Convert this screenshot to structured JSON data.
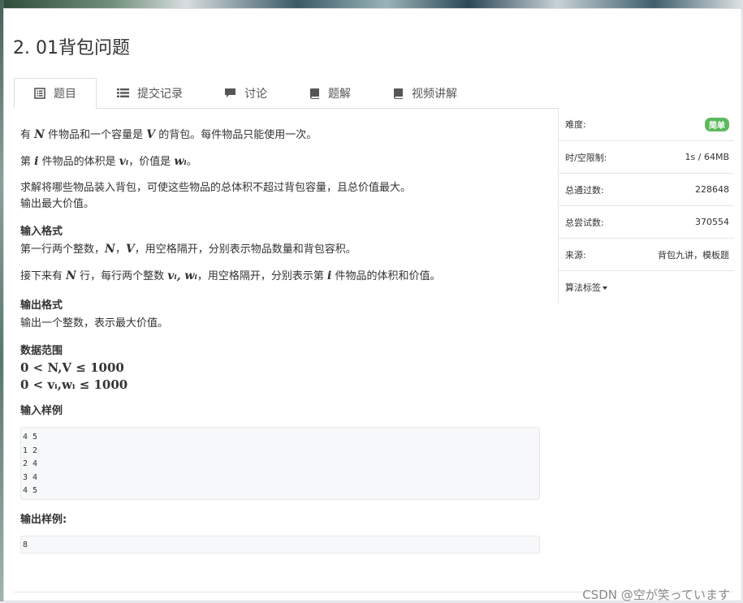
{
  "problem": {
    "title": "2. 01背包问题"
  },
  "tabs": [
    {
      "label": "题目",
      "icon": "list-alt-icon"
    },
    {
      "label": "提交记录",
      "icon": "list-icon"
    },
    {
      "label": "讨论",
      "icon": "comment-icon"
    },
    {
      "label": "题解",
      "icon": "book-icon"
    },
    {
      "label": "视频讲解",
      "icon": "book-icon"
    }
  ],
  "statement": {
    "line1_a": "有 ",
    "line1_N": "N",
    "line1_b": " 件物品和一个容量是 ",
    "line1_V": "V",
    "line1_c": " 的背包。每件物品只能使用一次。",
    "line2_a": "第 ",
    "line2_i": "i",
    "line2_b": " 件物品的体积是 ",
    "line2_vi": "vᵢ",
    "line2_c": "，价值是 ",
    "line2_wi": "wᵢ",
    "line2_d": "。",
    "line3": "求解将哪些物品装入背包，可使这些物品的总体积不超过背包容量，且总价值最大。",
    "line4": "输出最大价值。"
  },
  "input_format": {
    "heading": "输入格式",
    "line1_a": "第一行两个整数，",
    "line1_N": "N",
    "line1_b": "，",
    "line1_V": "V",
    "line1_c": "，用空格隔开，分别表示物品数量和背包容积。",
    "line2_a": "接下来有 ",
    "line2_N": "N",
    "line2_b": " 行，每行两个整数 ",
    "line2_vw": "vᵢ, wᵢ",
    "line2_c": "，用空格隔开，分别表示第 ",
    "line2_i": "i",
    "line2_d": " 件物品的体积和价值。"
  },
  "output_format": {
    "heading": "输出格式",
    "line": "输出一个整数，表示最大价值。"
  },
  "range": {
    "heading": "数据范围",
    "line1": "0 < N,V ≤ 1000",
    "line2": "0 < vᵢ,wᵢ ≤ 1000"
  },
  "sample_input": {
    "heading": "输入样例",
    "lines": [
      "4 5",
      "1 2",
      "2 4",
      "3 4",
      "4 5"
    ]
  },
  "sample_output": {
    "heading": "输出样例:",
    "lines": [
      "8"
    ]
  },
  "sidebar": {
    "rows": [
      {
        "label": "难度:",
        "value": "简单"
      },
      {
        "label": "时/空限制:",
        "value": "1s / 64MB"
      },
      {
        "label": "总通过数:",
        "value": "228648"
      },
      {
        "label": "总尝试数:",
        "value": "370554"
      },
      {
        "label": "来源:",
        "value": "背包九讲，模板题"
      }
    ],
    "tags_label": "算法标签"
  },
  "watermark": "CSDN @空が笑っています",
  "colors": {
    "badge": "#5cb85c",
    "codebox_bg": "#f6f8fa"
  }
}
